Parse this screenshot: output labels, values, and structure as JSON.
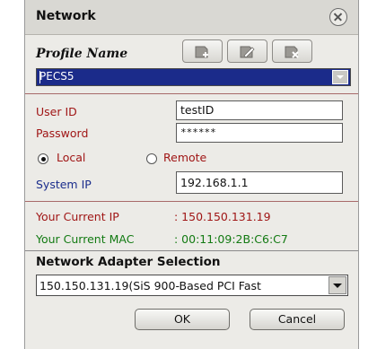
{
  "window": {
    "title": "Network"
  },
  "profile": {
    "label": "Profile Name",
    "selected": "PECS5",
    "toolbar": {
      "new_icon": "add-profile-icon",
      "edit_icon": "edit-profile-icon",
      "delete_icon": "delete-profile-icon"
    }
  },
  "credentials": {
    "user_id_label": "User ID",
    "user_id_value": "testID",
    "password_label": "Password",
    "password_value": "******"
  },
  "mode": {
    "local_label": "Local",
    "remote_label": "Remote",
    "selected": "Local"
  },
  "system_ip": {
    "label": "System IP",
    "value": "192.168.1.1"
  },
  "current": {
    "ip_label": "Your Current IP",
    "ip_value": ": 150.150.131.19",
    "mac_label": "Your Current MAC",
    "mac_value": ": 00:11:09:2B:C6:C7"
  },
  "adapter": {
    "title": "Network Adapter Selection",
    "selected": "150.150.131.19(SiS 900-Based PCI Fast"
  },
  "buttons": {
    "ok": "OK",
    "cancel": "Cancel"
  },
  "colors": {
    "label_red": "#a01616",
    "label_blue": "#1a2d8c",
    "label_green": "#127a12",
    "selection_blue": "#1b2b8a"
  }
}
